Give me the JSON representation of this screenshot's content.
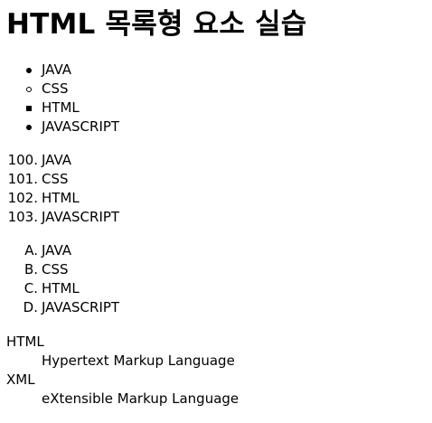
{
  "page_title": "HTML 목록형 요소 실습",
  "unordered_list": {
    "items": [
      {
        "label": "JAVA",
        "marker": "disc"
      },
      {
        "label": "CSS",
        "marker": "circle"
      },
      {
        "label": "HTML",
        "marker": "square"
      },
      {
        "label": "JAVASCRIPT",
        "marker": "disc"
      }
    ]
  },
  "numbered_list": {
    "items": [
      {
        "marker": "100.",
        "label": "JAVA"
      },
      {
        "marker": "101.",
        "label": "CSS"
      },
      {
        "marker": "102.",
        "label": "HTML"
      },
      {
        "marker": "103.",
        "label": "JAVASCRIPT"
      }
    ]
  },
  "alpha_list": {
    "items": [
      {
        "marker": "A.",
        "label": "JAVA"
      },
      {
        "marker": "B.",
        "label": "CSS"
      },
      {
        "marker": "C.",
        "label": "HTML"
      },
      {
        "marker": "D.",
        "label": "JAVASCRIPT"
      }
    ]
  },
  "definition_list": {
    "entries": [
      {
        "term": "HTML",
        "description": "Hypertext Markup Language"
      },
      {
        "term": "XML",
        "description": "eXtensible Markup Language"
      }
    ]
  }
}
